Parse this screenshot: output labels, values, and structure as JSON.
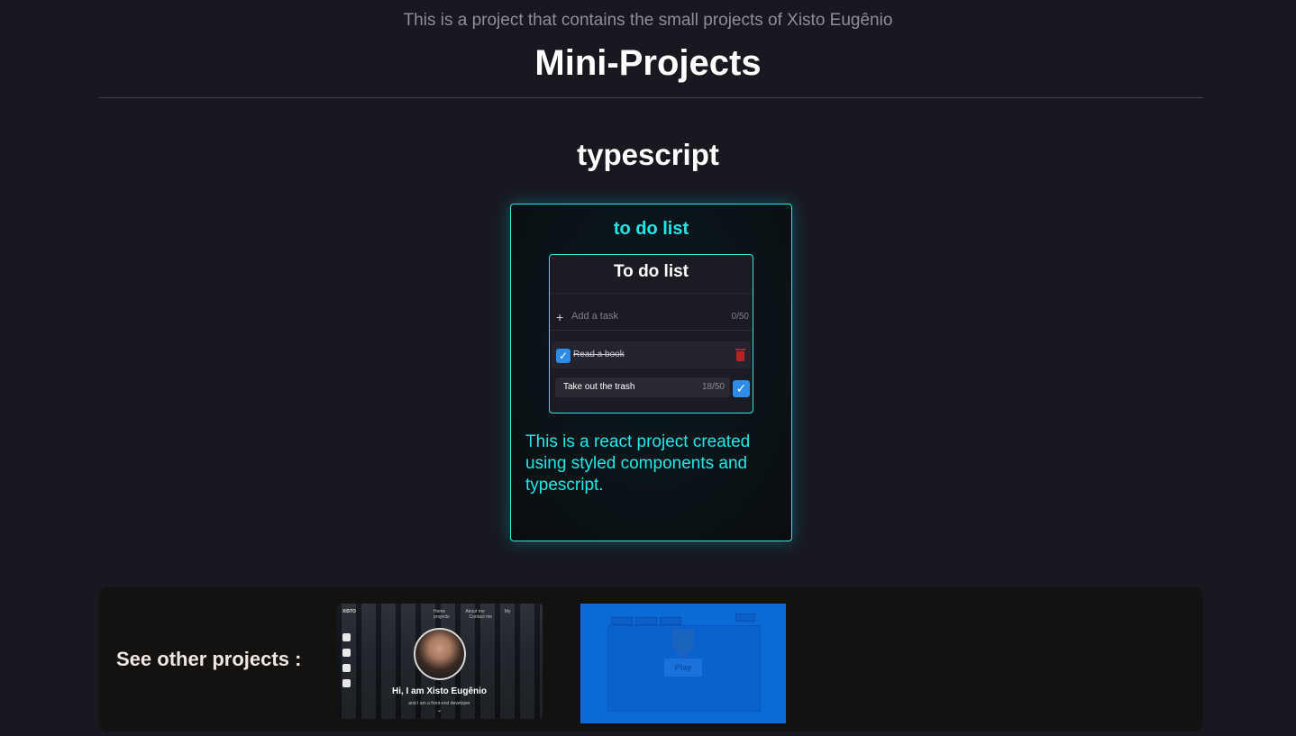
{
  "header": {
    "subtitle": "This is a project that contains the small projects of Xisto Eugênio",
    "title": "Mini-Projects"
  },
  "section": {
    "title": "typescript"
  },
  "project_card": {
    "title": "to do list",
    "description": "This is a react project created using styled components and typescript.",
    "preview": {
      "app_title": "To do list",
      "add_placeholder": "Add a task",
      "add_count": "0/50",
      "tasks": [
        {
          "label": "Read a book",
          "done": true
        },
        {
          "label": "Take out the trash",
          "count": "18/50"
        }
      ]
    }
  },
  "other_projects": {
    "label": "See other projects :",
    "portfolio": {
      "logo": "XISTO",
      "nav": [
        "Home",
        "About me",
        "My projects",
        "Contact me"
      ],
      "greeting": "Hi, I am Xisto Eugênio",
      "tagline": "and I am a front-end developer"
    },
    "game": {
      "play_label": "Play"
    }
  },
  "colors": {
    "accent": "#1ee8e8",
    "background": "#181820",
    "checkbox": "#2d8ce8",
    "delete": "#b82222",
    "game_bg": "#0a6ad6"
  }
}
